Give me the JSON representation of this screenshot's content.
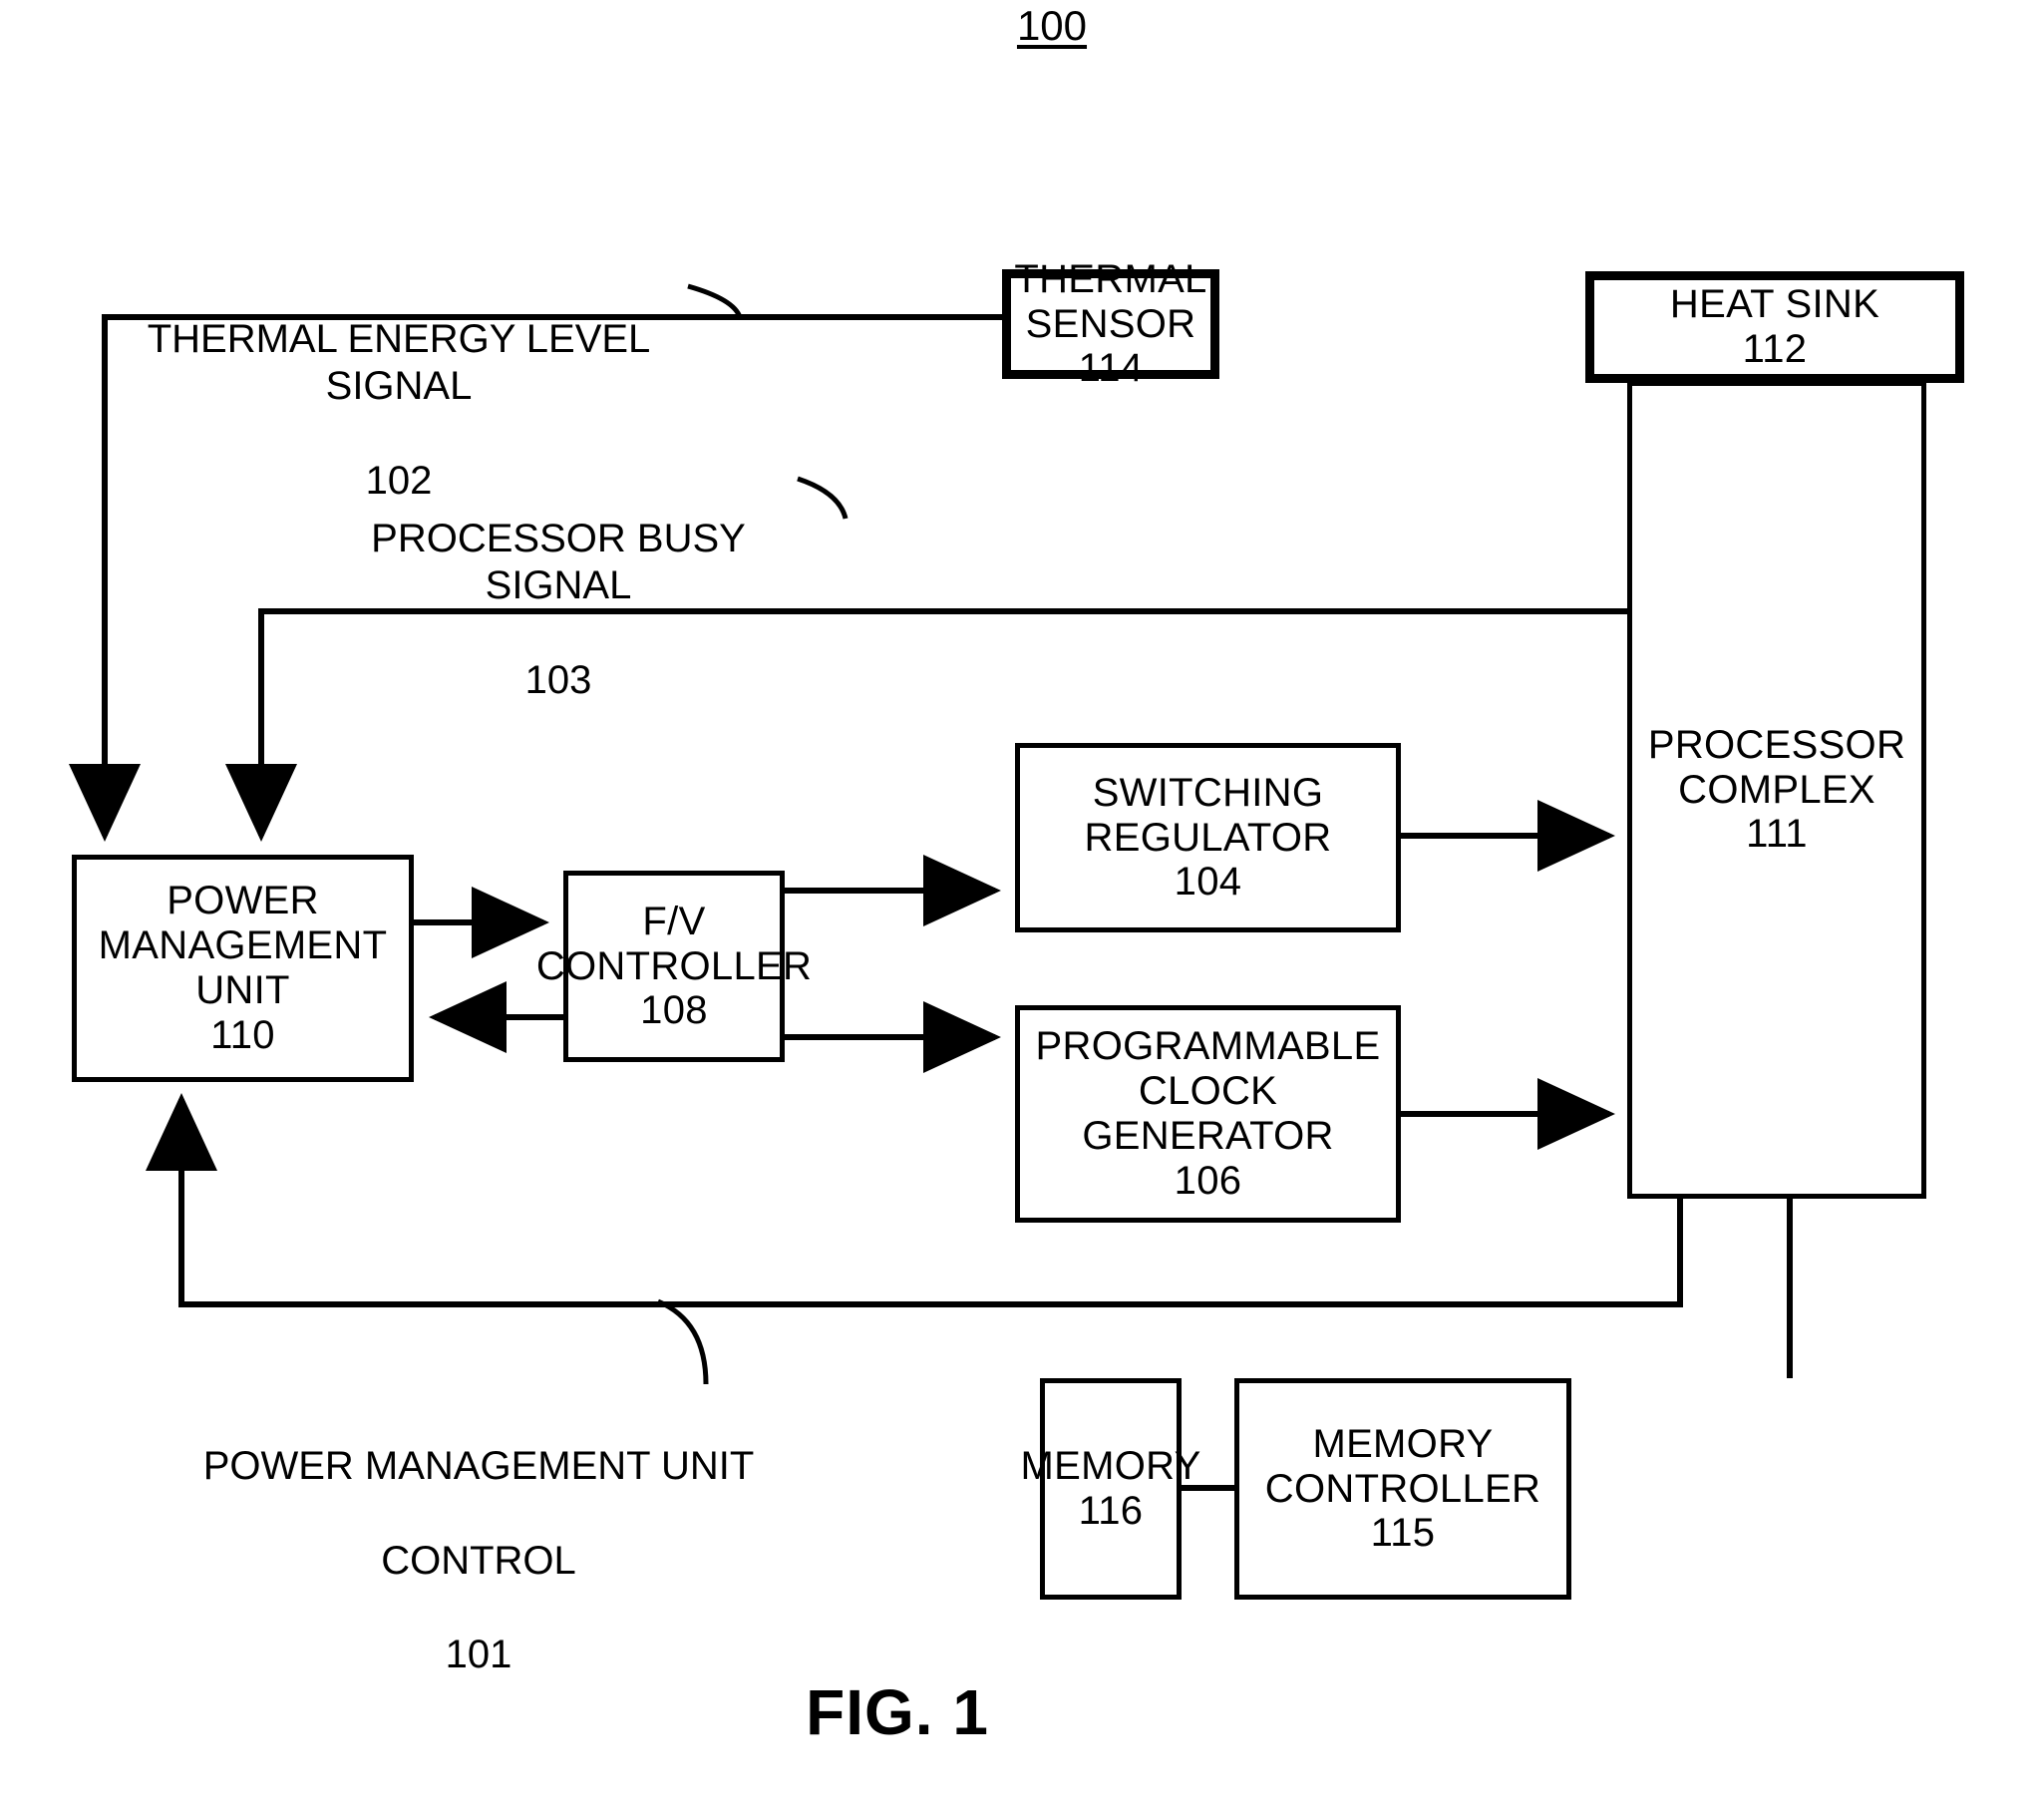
{
  "figure": {
    "number_label": "100",
    "caption": "FIG. 1"
  },
  "boxes": {
    "thermal_sensor": {
      "line1": "THERMAL",
      "line2": "SENSOR",
      "ref": "114"
    },
    "heat_sink": {
      "line1": "HEAT SINK",
      "ref": "112"
    },
    "processor_complex": {
      "line1": "PROCESSOR",
      "line2": "COMPLEX",
      "ref": "111"
    },
    "switching_regulator": {
      "line1": "SWITCHING",
      "line2": "REGULATOR",
      "ref": "104"
    },
    "programmable_clock_generator": {
      "line1": "PROGRAMMABLE",
      "line2": "CLOCK",
      "line3": "GENERATOR",
      "ref": "106"
    },
    "fv_controller": {
      "line1": "F/V",
      "line2": "CONTROLLER",
      "ref": "108"
    },
    "power_management_unit": {
      "line1": "POWER",
      "line2": "MANAGEMENT",
      "line3": "UNIT",
      "ref": "110"
    },
    "memory": {
      "line1": "MEMORY",
      "ref": "116"
    },
    "memory_controller": {
      "line1": "MEMORY",
      "line2": "CONTROLLER",
      "ref": "115"
    }
  },
  "signal_labels": {
    "thermal_energy_level_signal": {
      "text": "THERMAL ENERGY LEVEL SIGNAL",
      "ref": "102"
    },
    "processor_busy_signal": {
      "text": "PROCESSOR BUSY SIGNAL",
      "ref": "103"
    },
    "power_management_unit_control": {
      "line1": "POWER MANAGEMENT UNIT",
      "line2": "CONTROL",
      "ref": "101"
    }
  },
  "colors": {
    "stroke": "#000000",
    "background": "#ffffff"
  }
}
